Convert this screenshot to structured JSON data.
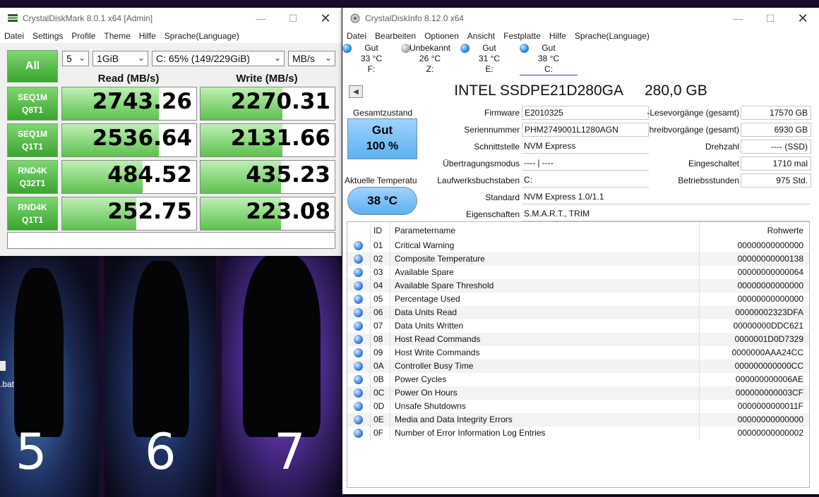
{
  "desktop": {
    "numbers": [
      "5",
      "6",
      "7"
    ],
    "file_label": ".bat"
  },
  "cdm": {
    "title": "CrystalDiskMark 8.0.1 x64 [Admin]",
    "menu": [
      "Datei",
      "Settings",
      "Profile",
      "Theme",
      "Hilfe",
      "Sprache(Language)"
    ],
    "all_label": "All",
    "count": "5",
    "size": "1GiB",
    "drive": "C: 65% (149/229GiB)",
    "unit": "MB/s",
    "read_header": "Read (MB/s)",
    "write_header": "Write (MB/s)",
    "rows": [
      {
        "l1": "SEQ1M",
        "l2": "Q8T1",
        "read": "2743.26",
        "write": "2270.31",
        "read_fill": 0.72,
        "write_fill": 0.61
      },
      {
        "l1": "SEQ1M",
        "l2": "Q1T1",
        "read": "2536.64",
        "write": "2131.66",
        "read_fill": 0.72,
        "write_fill": 0.61
      },
      {
        "l1": "RND4K",
        "l2": "Q32T1",
        "read": "484.52",
        "write": "435.23",
        "read_fill": 0.6,
        "write_fill": 0.6
      },
      {
        "l1": "RND4K",
        "l2": "Q1T1",
        "read": "252.75",
        "write": "223.08",
        "read_fill": 0.55,
        "write_fill": 0.6
      }
    ]
  },
  "cdi": {
    "title": "CrystalDiskInfo 8.12.0 x64",
    "menu": [
      "Datei",
      "Bearbeiten",
      "Optionen",
      "Ansicht",
      "Festplatte",
      "Hilfe",
      "Sprache(Language)"
    ],
    "drives": [
      {
        "status": "Gut",
        "temp": "33 °C",
        "letter": "F:",
        "color": "blue"
      },
      {
        "status": "Unbekannt",
        "temp": "26 °C",
        "letter": "Z:",
        "color": "gray"
      },
      {
        "status": "Gut",
        "temp": "31 °C",
        "letter": "E:",
        "color": "blue"
      },
      {
        "status": "Gut",
        "temp": "38 °C",
        "letter": "C:",
        "color": "blue"
      }
    ],
    "model": "INTEL SSDPE21D280GA",
    "capacity": "280,0 GB",
    "health_label": "Gesamtzustand",
    "health_status": "Gut",
    "health_percent": "100 %",
    "temp_label": "Aktuelle Temperatu",
    "temp_value": "38 °C",
    "firmware_label": "Firmware",
    "firmware": "E2010325",
    "serial_label": "Seriennummer",
    "serial": "PHM2749001L1280AGN",
    "interface_label": "Schnittstelle",
    "interface": "NVM Express",
    "transfer_label": "Übertragungsmodus",
    "transfer": "---- | ----",
    "letters_label": "Laufwerksbuchstaben",
    "letters": "C:",
    "standard_label": "Standard",
    "standard": "NVM Express 1.0/1.1",
    "features_label": "Eigenschaften",
    "features": "S.M.A.R.T., TRIM",
    "host_reads_label": "-Lesevorgänge (gesamt)",
    "host_reads": "17570 GB",
    "host_writes_label": "hreibvorgänge (gesamt)",
    "host_writes": "6930 GB",
    "rotation_label": "Drehzahl",
    "rotation": "---- (SSD)",
    "power_count_label": "Eingeschaltet",
    "power_count": "1710 mal",
    "power_hours_label": "Betriebsstunden",
    "power_hours": "975 Std.",
    "smart_headers": {
      "id": "ID",
      "name": "Parametername",
      "raw": "Rohwerte"
    },
    "smart": [
      {
        "id": "01",
        "name": "Critical Warning",
        "raw": "00000000000000"
      },
      {
        "id": "02",
        "name": "Composite Temperature",
        "raw": "00000000000138"
      },
      {
        "id": "03",
        "name": "Available Spare",
        "raw": "00000000000064"
      },
      {
        "id": "04",
        "name": "Available Spare Threshold",
        "raw": "00000000000000"
      },
      {
        "id": "05",
        "name": "Percentage Used",
        "raw": "00000000000000"
      },
      {
        "id": "06",
        "name": "Data Units Read",
        "raw": "00000002323DFA"
      },
      {
        "id": "07",
        "name": "Data Units Written",
        "raw": "00000000DDC621"
      },
      {
        "id": "08",
        "name": "Host Read Commands",
        "raw": "0000001D0D7329"
      },
      {
        "id": "09",
        "name": "Host Write Commands",
        "raw": "0000000AAA24CC"
      },
      {
        "id": "0A",
        "name": "Controller Busy Time",
        "raw": "000000000000CC"
      },
      {
        "id": "0B",
        "name": "Power Cycles",
        "raw": "000000000006AE"
      },
      {
        "id": "0C",
        "name": "Power On Hours",
        "raw": "000000000003CF"
      },
      {
        "id": "0D",
        "name": "Unsafe Shutdowns",
        "raw": "0000000000011F"
      },
      {
        "id": "0E",
        "name": "Media and Data Integrity Errors",
        "raw": "00000000000000"
      },
      {
        "id": "0F",
        "name": "Number of Error Information Log Entries",
        "raw": "00000000000002"
      }
    ]
  }
}
